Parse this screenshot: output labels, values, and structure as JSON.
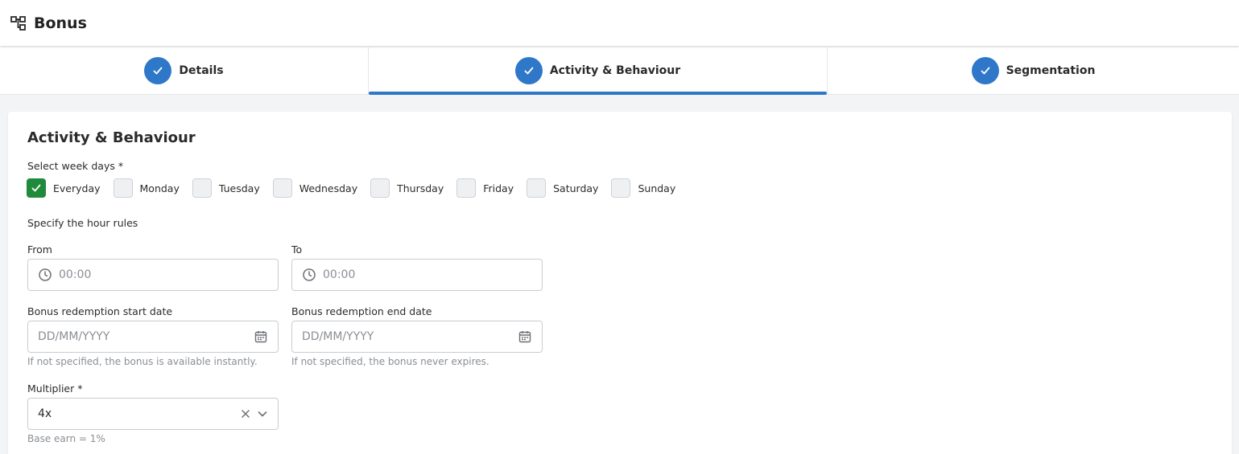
{
  "header": {
    "title": "Bonus",
    "icon": "hierarchy-icon"
  },
  "stepper": {
    "steps": [
      {
        "label": "Details",
        "state": "completed"
      },
      {
        "label": "Activity & Behaviour",
        "state": "active"
      },
      {
        "label": "Segmentation",
        "state": "completed"
      }
    ],
    "accent": "#2f78c9"
  },
  "form": {
    "title": "Activity & Behaviour",
    "weekdays": {
      "label": "Select week days *",
      "options": [
        {
          "label": "Everyday",
          "checked": true
        },
        {
          "label": "Monday",
          "checked": false
        },
        {
          "label": "Tuesday",
          "checked": false
        },
        {
          "label": "Wednesday",
          "checked": false
        },
        {
          "label": "Thursday",
          "checked": false
        },
        {
          "label": "Friday",
          "checked": false
        },
        {
          "label": "Saturday",
          "checked": false
        },
        {
          "label": "Sunday",
          "checked": false
        }
      ],
      "checked_color": "#1f8a3a"
    },
    "hours": {
      "label": "Specify the hour rules",
      "from": {
        "label": "From",
        "placeholder": "00:00",
        "value": ""
      },
      "to": {
        "label": "To",
        "placeholder": "00:00",
        "value": ""
      }
    },
    "start_date": {
      "label": "Bonus redemption start date",
      "placeholder": "DD/MM/YYYY",
      "value": "",
      "helper": "If not specified, the bonus is available instantly."
    },
    "end_date": {
      "label": "Bonus redemption end date",
      "placeholder": "DD/MM/YYYY",
      "value": "",
      "helper": "If not specified, the bonus never expires."
    },
    "multiplier": {
      "label": "Multiplier *",
      "value": "4x",
      "helper": "Base earn = 1%"
    }
  }
}
